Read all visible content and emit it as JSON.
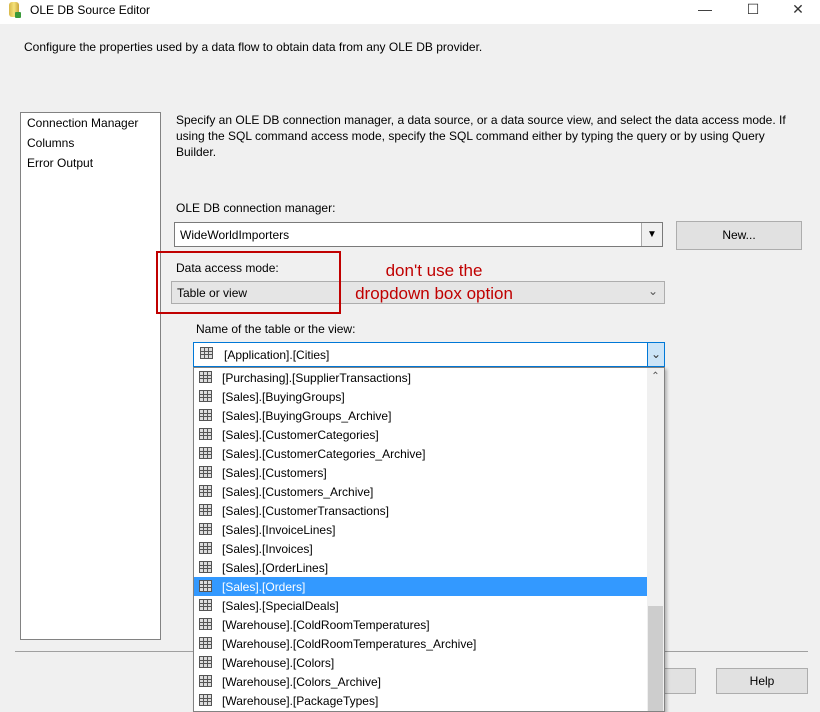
{
  "window": {
    "title": "OLE DB Source Editor",
    "minimize": "—",
    "maximize": "☐",
    "close": "✕"
  },
  "description": "Configure the properties used by a data flow to obtain data from any OLE DB provider.",
  "nav": {
    "items": [
      {
        "label": "Connection Manager"
      },
      {
        "label": "Columns"
      },
      {
        "label": "Error Output"
      }
    ]
  },
  "instructions": "Specify an OLE DB connection manager, a data source, or a data source view, and select the data access mode. If using the SQL command access mode, specify the SQL command either by typing the query or by using Query Builder.",
  "connection": {
    "label": "OLE DB connection manager:",
    "value": "WideWorldImporters",
    "new_label": "New..."
  },
  "access_mode": {
    "label": "Data access mode:",
    "value": "Table or view"
  },
  "annotation": {
    "line1": "don't use the",
    "line2": "dropdown box option",
    "color": "#c00000"
  },
  "table": {
    "label": "Name of the table or the view:",
    "value": "[Application].[Cities]"
  },
  "list": {
    "items": [
      "[Purchasing].[SupplierTransactions]",
      "[Sales].[BuyingGroups]",
      "[Sales].[BuyingGroups_Archive]",
      "[Sales].[CustomerCategories]",
      "[Sales].[CustomerCategories_Archive]",
      "[Sales].[Customers]",
      "[Sales].[Customers_Archive]",
      "[Sales].[CustomerTransactions]",
      "[Sales].[InvoiceLines]",
      "[Sales].[Invoices]",
      "[Sales].[OrderLines]",
      "[Sales].[Orders]",
      "[Sales].[SpecialDeals]",
      "[Warehouse].[ColdRoomTemperatures]",
      "[Warehouse].[ColdRoomTemperatures_Archive]",
      "[Warehouse].[Colors]",
      "[Warehouse].[Colors_Archive]",
      "[Warehouse].[PackageTypes]"
    ],
    "selected": "[Sales].[Orders]",
    "selection_color": "#3399ff"
  },
  "buttons": {
    "help": "Help"
  }
}
